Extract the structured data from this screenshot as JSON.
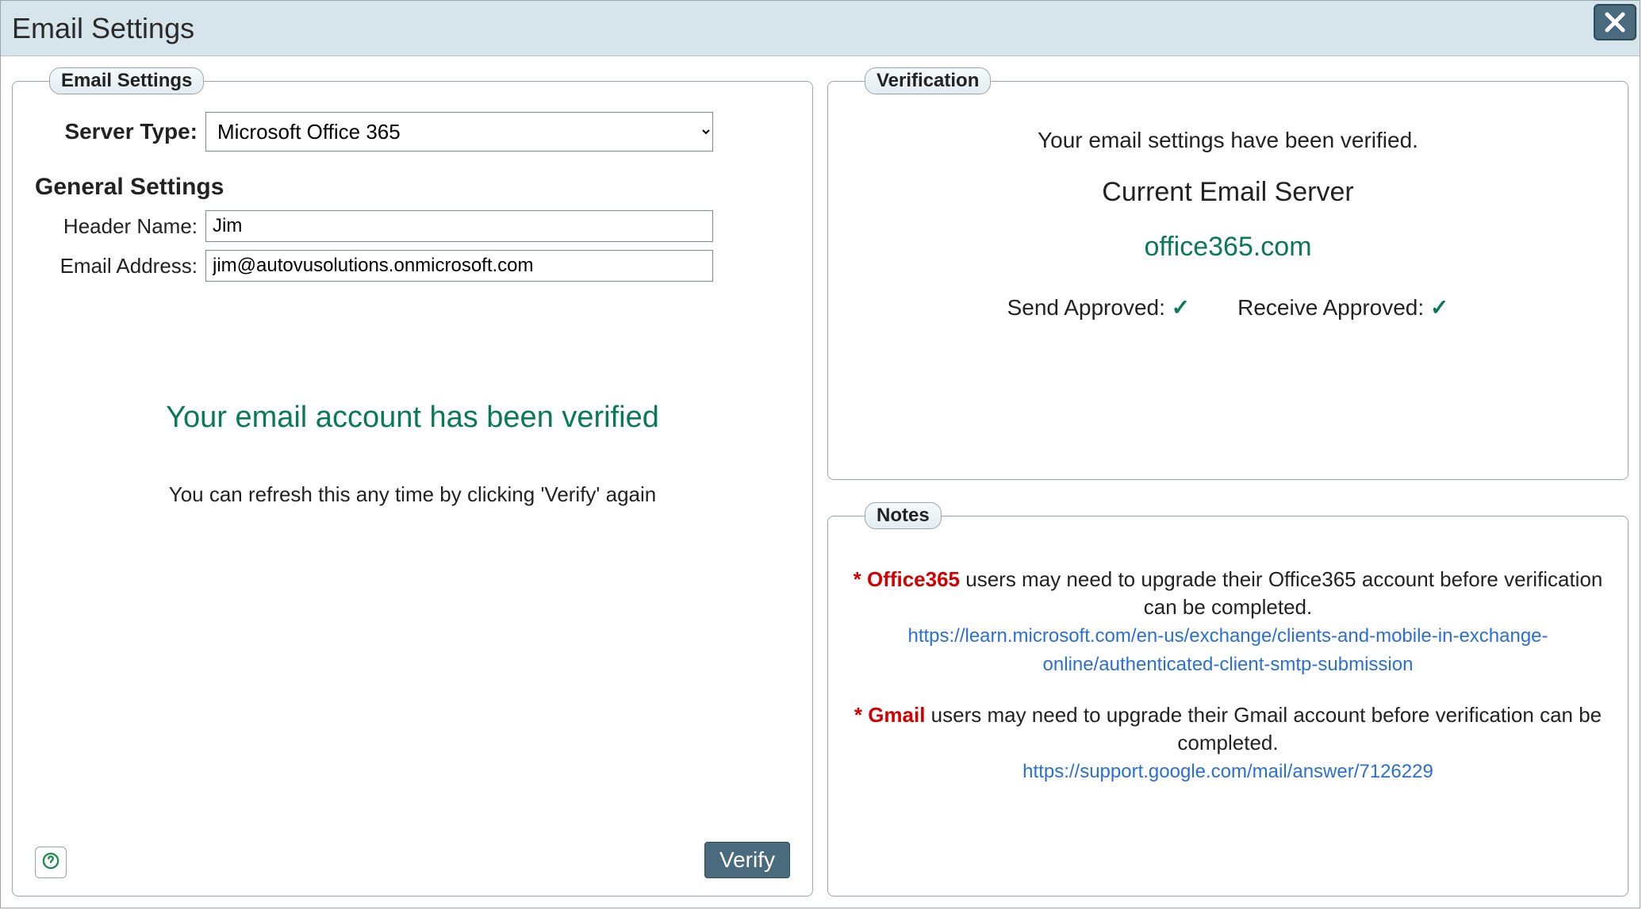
{
  "window": {
    "title": "Email Settings"
  },
  "emailSettings": {
    "legend": "Email Settings",
    "serverTypeLabel": "Server Type:",
    "serverTypeValue": "Microsoft Office 365",
    "generalHeading": "General Settings",
    "headerNameLabel": "Header Name:",
    "headerNameValue": "Jim",
    "emailAddressLabel": "Email Address:",
    "emailAddressValue": "jim@autovusolutions.onmicrosoft.com",
    "verifiedMessage": "Your email account has been verified",
    "verifiedHint": "You can refresh this any time by clicking 'Verify' again",
    "verifyButton": "Verify",
    "helpIcon": "?"
  },
  "verification": {
    "legend": "Verification",
    "statusMessage": "Your email settings have been verified.",
    "currentServerHeading": "Current Email Server",
    "currentServerValue": "office365.com",
    "sendLabel": "Send Approved: ",
    "receiveLabel": "Receive Approved: ",
    "checkmark": "✓"
  },
  "notes": {
    "legend": "Notes",
    "items": [
      {
        "star": "* ",
        "provider": "Office365",
        "text": " users may need to upgrade their Office365 account before verification can be completed.",
        "link": "https://learn.microsoft.com/en-us/exchange/clients-and-mobile-in-exchange-online/authenticated-client-smtp-submission"
      },
      {
        "star": "* ",
        "provider": "Gmail",
        "text": " users may need to upgrade their Gmail account before verification can be completed.",
        "link": "https://support.google.com/mail/answer/7126229"
      }
    ]
  }
}
